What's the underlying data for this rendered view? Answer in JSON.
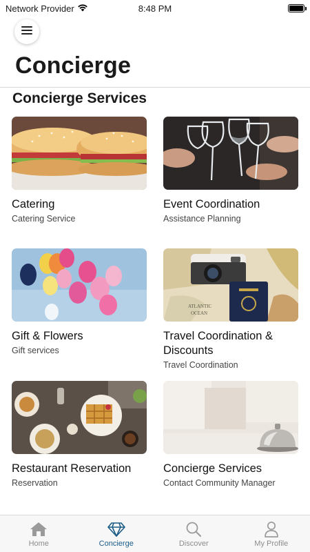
{
  "status_bar": {
    "carrier": "Network Provider",
    "time": "8:48 PM"
  },
  "header": {
    "title": "Concierge"
  },
  "section": {
    "title": "Concierge Services"
  },
  "services": [
    {
      "title": "Catering",
      "subtitle": "Catering Service",
      "image": "sandwich-photo"
    },
    {
      "title": "Event Coordination",
      "subtitle": "Assistance Planning",
      "image": "wine-toast-photo"
    },
    {
      "title": "Gift & Flowers",
      "subtitle": "Gift services",
      "image": "balloons-photo"
    },
    {
      "title": "Travel Coordination & Discounts",
      "subtitle": "Travel Coordination",
      "image": "passport-camera-map-photo"
    },
    {
      "title": "Restaurant Reservation",
      "subtitle": "Reservation",
      "image": "restaurant-table-photo"
    },
    {
      "title": "Concierge Services",
      "subtitle": "Contact Community Manager",
      "image": "service-bell-photo"
    }
  ],
  "tabs": [
    {
      "label": "Home",
      "icon": "home-icon",
      "active": false
    },
    {
      "label": "Concierge",
      "icon": "diamond-icon",
      "active": true
    },
    {
      "label": "Discover",
      "icon": "search-icon",
      "active": false
    },
    {
      "label": "My Profile",
      "icon": "person-icon",
      "active": false
    }
  ],
  "colors": {
    "accent": "#1b5b86",
    "inactive": "#8c8c8c",
    "divider": "#d6d6d6"
  }
}
